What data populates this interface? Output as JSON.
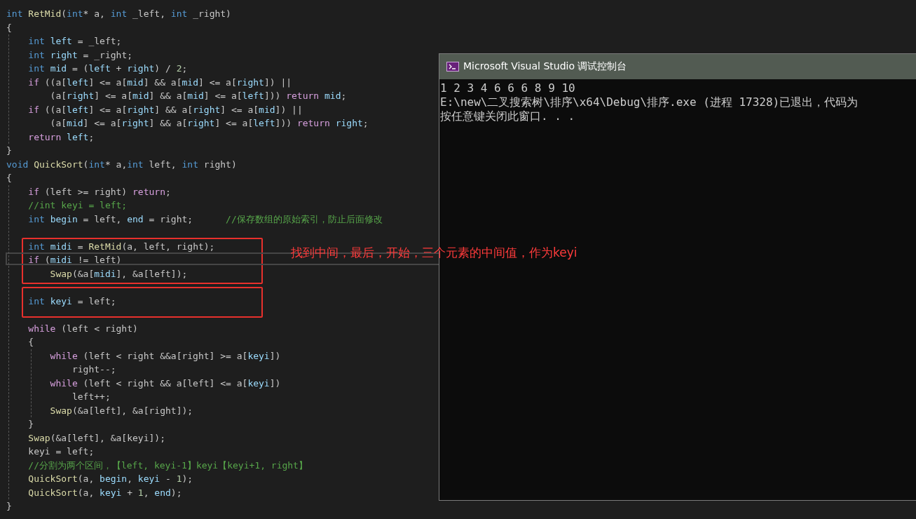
{
  "editor": {
    "lines": [
      {
        "kind": "code",
        "tokens": [
          {
            "text": "int ",
            "kind": "k"
          },
          {
            "text": "RetMid",
            "kind": "f"
          },
          {
            "text": "(",
            "kind": "p"
          },
          {
            "text": "int",
            "kind": "k"
          },
          {
            "text": "* a, ",
            "kind": "p"
          },
          {
            "text": "int",
            "kind": "k"
          },
          {
            "text": " _left, ",
            "kind": "p"
          },
          {
            "text": "int",
            "kind": "k"
          },
          {
            "text": " _right)",
            "kind": "p"
          }
        ]
      },
      {
        "kind": "code",
        "tokens": [
          {
            "text": "{",
            "kind": "p"
          }
        ]
      },
      {
        "kind": "code",
        "tokens": [
          {
            "text": "    int ",
            "kind": "k"
          },
          {
            "text": "left",
            "kind": "v"
          },
          {
            "text": " = _left;",
            "kind": "p"
          }
        ]
      },
      {
        "kind": "code",
        "tokens": [
          {
            "text": "    int ",
            "kind": "k"
          },
          {
            "text": "right",
            "kind": "v"
          },
          {
            "text": " = _right;",
            "kind": "p"
          }
        ]
      },
      {
        "kind": "code",
        "tokens": [
          {
            "text": "    int ",
            "kind": "k"
          },
          {
            "text": "mid",
            "kind": "v"
          },
          {
            "text": " = (",
            "kind": "p"
          },
          {
            "text": "left",
            "kind": "v"
          },
          {
            "text": " + ",
            "kind": "p"
          },
          {
            "text": "right",
            "kind": "v"
          },
          {
            "text": ") / ",
            "kind": "p"
          },
          {
            "text": "2",
            "kind": "n"
          },
          {
            "text": ";",
            "kind": "p"
          }
        ]
      },
      {
        "kind": "code",
        "tokens": [
          {
            "text": "    if",
            "kind": "c"
          },
          {
            "text": " ((a[",
            "kind": "p"
          },
          {
            "text": "left",
            "kind": "v"
          },
          {
            "text": "] <= a[",
            "kind": "p"
          },
          {
            "text": "mid",
            "kind": "v"
          },
          {
            "text": "] && a[",
            "kind": "p"
          },
          {
            "text": "mid",
            "kind": "v"
          },
          {
            "text": "] <= a[",
            "kind": "p"
          },
          {
            "text": "right",
            "kind": "v"
          },
          {
            "text": "]) ||",
            "kind": "p"
          }
        ]
      },
      {
        "kind": "code",
        "tokens": [
          {
            "text": "        (a[",
            "kind": "p"
          },
          {
            "text": "right",
            "kind": "v"
          },
          {
            "text": "] <= a[",
            "kind": "p"
          },
          {
            "text": "mid",
            "kind": "v"
          },
          {
            "text": "] && a[",
            "kind": "p"
          },
          {
            "text": "mid",
            "kind": "v"
          },
          {
            "text": "] <= a[",
            "kind": "p"
          },
          {
            "text": "left",
            "kind": "v"
          },
          {
            "text": "])) ",
            "kind": "p"
          },
          {
            "text": "return ",
            "kind": "c"
          },
          {
            "text": "mid",
            "kind": "v"
          },
          {
            "text": ";",
            "kind": "p"
          }
        ]
      },
      {
        "kind": "code",
        "tokens": [
          {
            "text": "    if",
            "kind": "c"
          },
          {
            "text": " ((a[",
            "kind": "p"
          },
          {
            "text": "left",
            "kind": "v"
          },
          {
            "text": "] <= a[",
            "kind": "p"
          },
          {
            "text": "right",
            "kind": "v"
          },
          {
            "text": "] && a[",
            "kind": "p"
          },
          {
            "text": "right",
            "kind": "v"
          },
          {
            "text": "] <= a[",
            "kind": "p"
          },
          {
            "text": "mid",
            "kind": "v"
          },
          {
            "text": "]) ||",
            "kind": "p"
          }
        ]
      },
      {
        "kind": "code",
        "tokens": [
          {
            "text": "        (a[",
            "kind": "p"
          },
          {
            "text": "mid",
            "kind": "v"
          },
          {
            "text": "] <= a[",
            "kind": "p"
          },
          {
            "text": "right",
            "kind": "v"
          },
          {
            "text": "] && a[",
            "kind": "p"
          },
          {
            "text": "right",
            "kind": "v"
          },
          {
            "text": "] <= a[",
            "kind": "p"
          },
          {
            "text": "left",
            "kind": "v"
          },
          {
            "text": "])) ",
            "kind": "p"
          },
          {
            "text": "return ",
            "kind": "c"
          },
          {
            "text": "right",
            "kind": "v"
          },
          {
            "text": ";",
            "kind": "p"
          }
        ]
      },
      {
        "kind": "code",
        "tokens": [
          {
            "text": "    return ",
            "kind": "c"
          },
          {
            "text": "left",
            "kind": "v"
          },
          {
            "text": ";",
            "kind": "p"
          }
        ]
      },
      {
        "kind": "code",
        "tokens": [
          {
            "text": "}",
            "kind": "p"
          }
        ]
      },
      {
        "kind": "code",
        "tokens": [
          {
            "text": "void ",
            "kind": "k"
          },
          {
            "text": "QuickSort",
            "kind": "f"
          },
          {
            "text": "(",
            "kind": "p"
          },
          {
            "text": "int",
            "kind": "k"
          },
          {
            "text": "* a,",
            "kind": "p"
          },
          {
            "text": "int",
            "kind": "k"
          },
          {
            "text": " left, ",
            "kind": "p"
          },
          {
            "text": "int",
            "kind": "k"
          },
          {
            "text": " right)",
            "kind": "p"
          }
        ]
      },
      {
        "kind": "code",
        "tokens": [
          {
            "text": "{",
            "kind": "p"
          }
        ]
      },
      {
        "kind": "code",
        "tokens": [
          {
            "text": "    if",
            "kind": "c"
          },
          {
            "text": " (left >= right) ",
            "kind": "p"
          },
          {
            "text": "return",
            "kind": "c"
          },
          {
            "text": ";",
            "kind": "p"
          }
        ]
      },
      {
        "kind": "code",
        "tokens": [
          {
            "text": "    //int keyi = left;",
            "kind": "g"
          }
        ]
      },
      {
        "kind": "code",
        "tokens": [
          {
            "text": "    int ",
            "kind": "k"
          },
          {
            "text": "begin",
            "kind": "v"
          },
          {
            "text": " = left, ",
            "kind": "p"
          },
          {
            "text": "end",
            "kind": "v"
          },
          {
            "text": " = right;      ",
            "kind": "p"
          },
          {
            "text": "//保存数组的原始索引，防止后面修改",
            "kind": "g"
          }
        ]
      },
      {
        "kind": "blank"
      },
      {
        "kind": "code",
        "tokens": [
          {
            "text": "    int ",
            "kind": "k"
          },
          {
            "text": "midi",
            "kind": "v"
          },
          {
            "text": " = ",
            "kind": "p"
          },
          {
            "text": "RetMid",
            "kind": "f"
          },
          {
            "text": "(a, left, right);",
            "kind": "p"
          }
        ]
      },
      {
        "kind": "code",
        "tokens": [
          {
            "text": "    if",
            "kind": "c"
          },
          {
            "text": " (",
            "kind": "p"
          },
          {
            "text": "midi",
            "kind": "v"
          },
          {
            "text": " != left)",
            "kind": "p"
          }
        ]
      },
      {
        "kind": "code",
        "tokens": [
          {
            "text": "        Swap",
            "kind": "f"
          },
          {
            "text": "(&a[",
            "kind": "p"
          },
          {
            "text": "midi",
            "kind": "v"
          },
          {
            "text": "], &a[left]);",
            "kind": "p"
          }
        ]
      },
      {
        "kind": "blank"
      },
      {
        "kind": "code",
        "tokens": [
          {
            "text": "    int ",
            "kind": "k"
          },
          {
            "text": "keyi",
            "kind": "v"
          },
          {
            "text": " = left;",
            "kind": "p"
          }
        ]
      },
      {
        "kind": "blank"
      },
      {
        "kind": "code",
        "tokens": [
          {
            "text": "    while",
            "kind": "c"
          },
          {
            "text": " (left < right)",
            "kind": "p"
          }
        ]
      },
      {
        "kind": "code",
        "tokens": [
          {
            "text": "    {",
            "kind": "p"
          }
        ]
      },
      {
        "kind": "code",
        "tokens": [
          {
            "text": "        while",
            "kind": "c"
          },
          {
            "text": " (left < right &&a[right] >= a[",
            "kind": "p"
          },
          {
            "text": "keyi",
            "kind": "v"
          },
          {
            "text": "])",
            "kind": "p"
          }
        ]
      },
      {
        "kind": "code",
        "tokens": [
          {
            "text": "            right--;",
            "kind": "p"
          }
        ]
      },
      {
        "kind": "code",
        "tokens": [
          {
            "text": "        while",
            "kind": "c"
          },
          {
            "text": " (left < right && a[left] <= a[",
            "kind": "p"
          },
          {
            "text": "keyi",
            "kind": "v"
          },
          {
            "text": "])",
            "kind": "p"
          }
        ]
      },
      {
        "kind": "code",
        "tokens": [
          {
            "text": "            left++;",
            "kind": "p"
          }
        ]
      },
      {
        "kind": "code",
        "tokens": [
          {
            "text": "        Swap",
            "kind": "f"
          },
          {
            "text": "(&a[left], &a[right]);",
            "kind": "p"
          }
        ]
      },
      {
        "kind": "code",
        "tokens": [
          {
            "text": "    }",
            "kind": "p"
          }
        ]
      },
      {
        "kind": "code",
        "tokens": [
          {
            "text": "    Swap",
            "kind": "f"
          },
          {
            "text": "(&a[left], &a[keyi]);",
            "kind": "p"
          }
        ]
      },
      {
        "kind": "code",
        "tokens": [
          {
            "text": "    keyi = left;",
            "kind": "p"
          }
        ]
      },
      {
        "kind": "code",
        "tokens": [
          {
            "text": "    //分割为两个区间，【left, keyi-1】keyi【keyi+1, right】",
            "kind": "g"
          }
        ]
      },
      {
        "kind": "code",
        "tokens": [
          {
            "text": "    QuickSort",
            "kind": "f"
          },
          {
            "text": "(a, ",
            "kind": "p"
          },
          {
            "text": "begin",
            "kind": "v"
          },
          {
            "text": ", ",
            "kind": "p"
          },
          {
            "text": "keyi",
            "kind": "v"
          },
          {
            "text": " - ",
            "kind": "p"
          },
          {
            "text": "1",
            "kind": "n"
          },
          {
            "text": ");",
            "kind": "p"
          }
        ]
      },
      {
        "kind": "code",
        "tokens": [
          {
            "text": "    QuickSort",
            "kind": "f"
          },
          {
            "text": "(a, ",
            "kind": "p"
          },
          {
            "text": "keyi",
            "kind": "v"
          },
          {
            "text": " + ",
            "kind": "p"
          },
          {
            "text": "1",
            "kind": "n"
          },
          {
            "text": ", ",
            "kind": "p"
          },
          {
            "text": "end",
            "kind": "v"
          },
          {
            "text": ");",
            "kind": "p"
          }
        ]
      },
      {
        "kind": "code",
        "tokens": [
          {
            "text": "}",
            "kind": "p"
          }
        ]
      }
    ]
  },
  "annotation": {
    "text": "找到中间，最后，开始，三个元素的中间值，作为keyi"
  },
  "console": {
    "title": "Microsoft Visual Studio 调试控制台",
    "lines": [
      "1 2 3 4 6 6 6 8 9 10",
      "E:\\new\\二叉搜索树\\排序\\x64\\Debug\\排序.exe (进程 17328)已退出，代码为",
      "按任意键关闭此窗口. . ."
    ]
  }
}
